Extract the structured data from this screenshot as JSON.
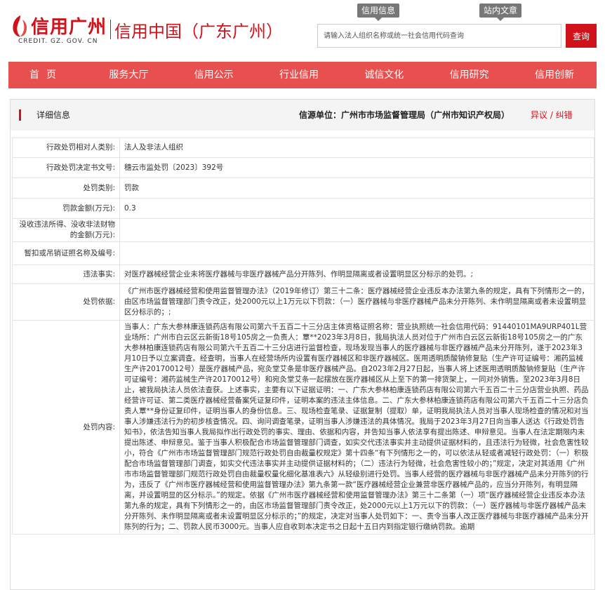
{
  "header": {
    "logo_title": "信用广州",
    "logo_sub": "CREDIT. GZ. GOV. CN",
    "site_title": "信用中国（广东广州）",
    "top_tabs": [
      "信用信息",
      "站内文章"
    ],
    "search_placeholder": "请输入法人组织名称或统一社会信用代码查询",
    "search_button": "查询"
  },
  "nav": [
    "首页",
    "服务大厅",
    "信用公示",
    "行业信用",
    "诚信文化",
    "信用研究",
    "信用创新"
  ],
  "detail": {
    "title": "详细信息",
    "source": "信源单位：广州市市场监督管理局（广州市知识产权局）",
    "report": "异议 / 纠错",
    "rows": [
      {
        "label": "行政处罚相对人类别:",
        "value": "法人及非法人组织"
      },
      {
        "label": "行政处罚决定书文号:",
        "value": "穗云市监处罚〔2023〕392号"
      },
      {
        "label": "处罚类别:",
        "value": "罚款"
      },
      {
        "label": "罚款金额(万元):",
        "value": "0.3"
      },
      {
        "label": "没收违法所得、没收非法财物的金额(万元):",
        "value": ""
      },
      {
        "label": "暂扣或吊销证照名称及编号:",
        "value": ""
      },
      {
        "label": "违法事实:",
        "value": "对医疗器械经营企业未将医疗器械与非医疗器械产品分开陈列、作明显隔离或者设置明显区分标示的处罚。;"
      },
      {
        "label": "处罚依据:",
        "value": "《广州市医疗器械经营和使用监督管理办法》（2019年修订）第三十二条：医疗器械经营企业违反本办法第九条的规定，具有下列情形之一的，由区市场监督管理部门责令改正，处2000元以上1万元以下罚款：（一）医疗器械与非医疗器械产品未分开陈列、未作明显隔离或者未设置明显区分标示的；;"
      },
      {
        "label": "处罚内容:",
        "value": "当事人：广东大参林康连锁药店有限公司第六千五百二十三分店主体资格证照名称：营业执照统一社会信用代码：91440101MA9URP401L营业场所：广州市白云区云新街18号105房之一负责人：覃**2023年3月8日，我局执法人员对位于广州市白云区云新街18号105房之一的广东大参林柏康连锁药店有限公司第六千五百二十三分店进行监督检查，现场发现当事人的医疗器械与非医疗器械产品未分开陈列，遂于2023年3月10日予以立案调查。经查明，当事人在经营场所内设置有医疗器械区和非医疗器械区。医用透明质酸钠修复贴（生产许可证编号：湘药监械生产许20170012号）是医疗器械产品，宛灸堂艾条是非医疗器械产品。自2023年2月27日起，当事人将上述医用透明质酸钠修复贴（生产许可证编号：湘药监械生产许20170012号）和宛灸堂艾条一起摆放在医疗器械区从上至下的第一排货架上，一同对外销售。至2023年3月8日止，被我局执法人员依法查获。上述事实，主要有以下证据证明：一、广东大参林柏康连锁药店有限公司第六千五百二十三分店营业执照、药品经营许可证、第二类医疗器械经营备案凭证复印件，证明本案的违法主体信息。二、广东大参林柏康连锁药店有限公司第六千五百二十三分店负责人覃**身份证复印件，证明当事人的身份信息。三、现场检查笔录、证据复制（提取）单，证明我局执法人员对当事人现场检查的情况和对当事人涉嫌违法行为的初步核查情况。四、询问调查笔录，证明当事人涉嫌违法的具体情况。我局于2023年3月27日向当事人送达《行政处罚告知书》，依法告知当事人我局拟作出行政处罚的事实、理由、依据和内容，并告知当事人依法享有提出陈述、申辩意见。当事人在法定期限内未提出陈述、申辩意见。鉴于当事人积极配合市场监督管理部门调查，如实交代违法事实并主动提供证据材料的，且违法行为轻微，社会危害性较小，符合《广州市市场监督管理部门规范行政处罚自由裁量权规定》第十四条“有下列情形之一的，可以依法从轻或者减轻行政处罚：（一）积极配合市场监督管理部门调查，如实交代违法事实并主动提供证据材料的；（二）违法行为轻微，社会危害性较小的；”规定，决定对其适用《广州市市场监督管理部门规范行政处罚自由裁量权量化细化基准表六》从轻级别进行处罚。当事人经营的医疗器械与非医疗器械产品未分开陈列的行为，违反了《广州市医疗器械经营和使用监督管理办法》第九条第一款“医疗器械经营企业兼营非医疗器械产品的，应当分开陈列，有明显隔离，并设置明显的区分标示。”的规定。依据《广州市医疗器械经营和使用监督管理办法》第三十二条第（一）项“医疗器械经营企业违反本办法第九条的规定，具有下列情形之一的，由区市场监督管理部门责令改正，处2000元以上1万元以下的罚款：（一）医疗器械与非医疗器械产品未分开陈列、未作明显隔离或者未设置明显区分标示的；”的规定，决定对当事人处罚如下：一、责令当事人改正医疗器械与非医疗器械产品未分开陈列的行为；二、罚款人民币3000元。当事人应自收到本决定书之日起十五日内到指定银行缴纳罚款。逾期"
      }
    ]
  },
  "colors": {
    "brand_red": "#d0121b",
    "nav_red": "#e84f4f"
  }
}
